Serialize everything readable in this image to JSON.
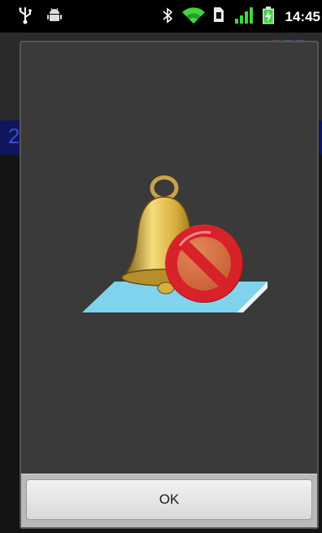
{
  "status_bar": {
    "time": "14:45",
    "icons": [
      "usb-icon",
      "android-debug-icon",
      "bluetooth-icon",
      "wifi-icon",
      "sim-card-icon",
      "signal-bars-icon",
      "battery-charging-icon"
    ]
  },
  "background_app": {
    "visible_digit": "2"
  },
  "dialog": {
    "image": "notification-muted-icon",
    "ok_label": "OK"
  },
  "colors": {
    "dialog_background": "#3a3a3a",
    "button_bar": "#b9b9b9",
    "wifi_green": "#3fd83f",
    "bell_gold": "#d9b24a",
    "no_sign_red": "#d8222a",
    "mat_blue": "#7fd3ec"
  }
}
